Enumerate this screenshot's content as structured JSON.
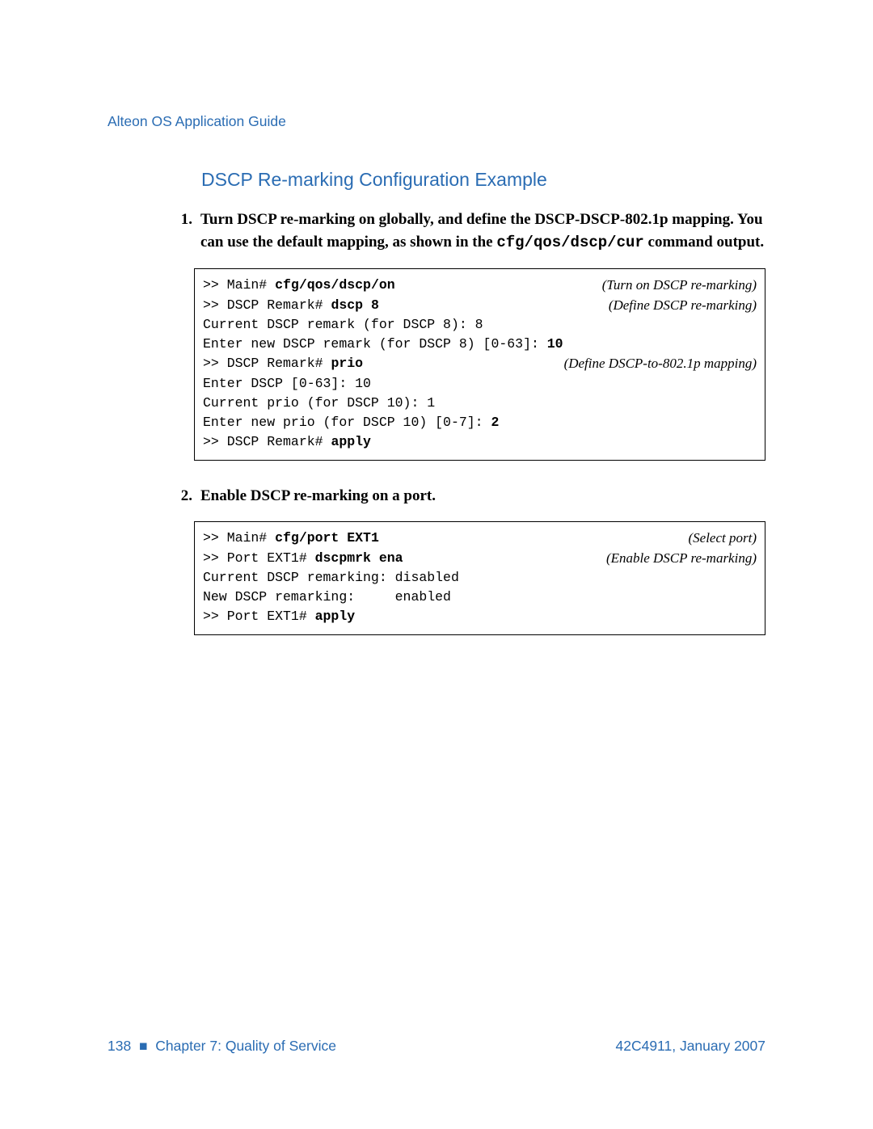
{
  "header_title": "Alteon OS Application Guide",
  "section_title": "DSCP Re-marking Configuration Example",
  "steps": {
    "s1": {
      "num": "1.",
      "text_pre": "Turn DSCP re-marking on globally, and define the DSCP-DSCP-802.1p mapping. You can use the default mapping, as shown in the ",
      "text_cmd": "cfg/qos/dscp/cur",
      "text_post": " command output."
    },
    "s2": {
      "num": "2.",
      "text": "Enable DSCP re-marking on a port."
    }
  },
  "code1": {
    "l1_prompt": ">> Main# ",
    "l1_cmd": "cfg/qos/dscp/on",
    "l1_annot": "(Turn on DSCP re-marking)",
    "l2_prompt": ">> DSCP Remark# ",
    "l2_cmd": "dscp 8",
    "l2_annot": "(Define DSCP re-marking)",
    "l3": "Current DSCP remark (for DSCP 8): 8",
    "l4_pre": "Enter new DSCP remark (for DSCP 8) [0-63]: ",
    "l4_bold": "10",
    "l5_prompt": ">> DSCP Remark# ",
    "l5_cmd": "prio",
    "l5_annot": "(Define DSCP-to-802.1p mapping)",
    "l6": "Enter DSCP [0-63]: 10",
    "l7": "Current prio (for DSCP 10): 1",
    "l8_pre": "Enter new prio (for DSCP 10) [0-7]: ",
    "l8_bold": "2",
    "l9_prompt": ">> DSCP Remark# ",
    "l9_cmd": "apply"
  },
  "code2": {
    "l1_prompt": ">> Main# ",
    "l1_cmd": "cfg/port EXT1",
    "l1_annot": "(Select port)",
    "l2_prompt": ">> Port EXT1# ",
    "l2_cmd": "dscpmrk ena",
    "l2_annot": "(Enable DSCP re-marking)",
    "l3": "Current DSCP remarking: disabled",
    "l4": "New DSCP remarking:     enabled",
    "l5_prompt": ">> Port EXT1# ",
    "l5_cmd": "apply"
  },
  "footer": {
    "page_num": "138",
    "sep": "■",
    "chapter": "Chapter 7: Quality of Service",
    "docref": "42C4911, January 2007"
  }
}
